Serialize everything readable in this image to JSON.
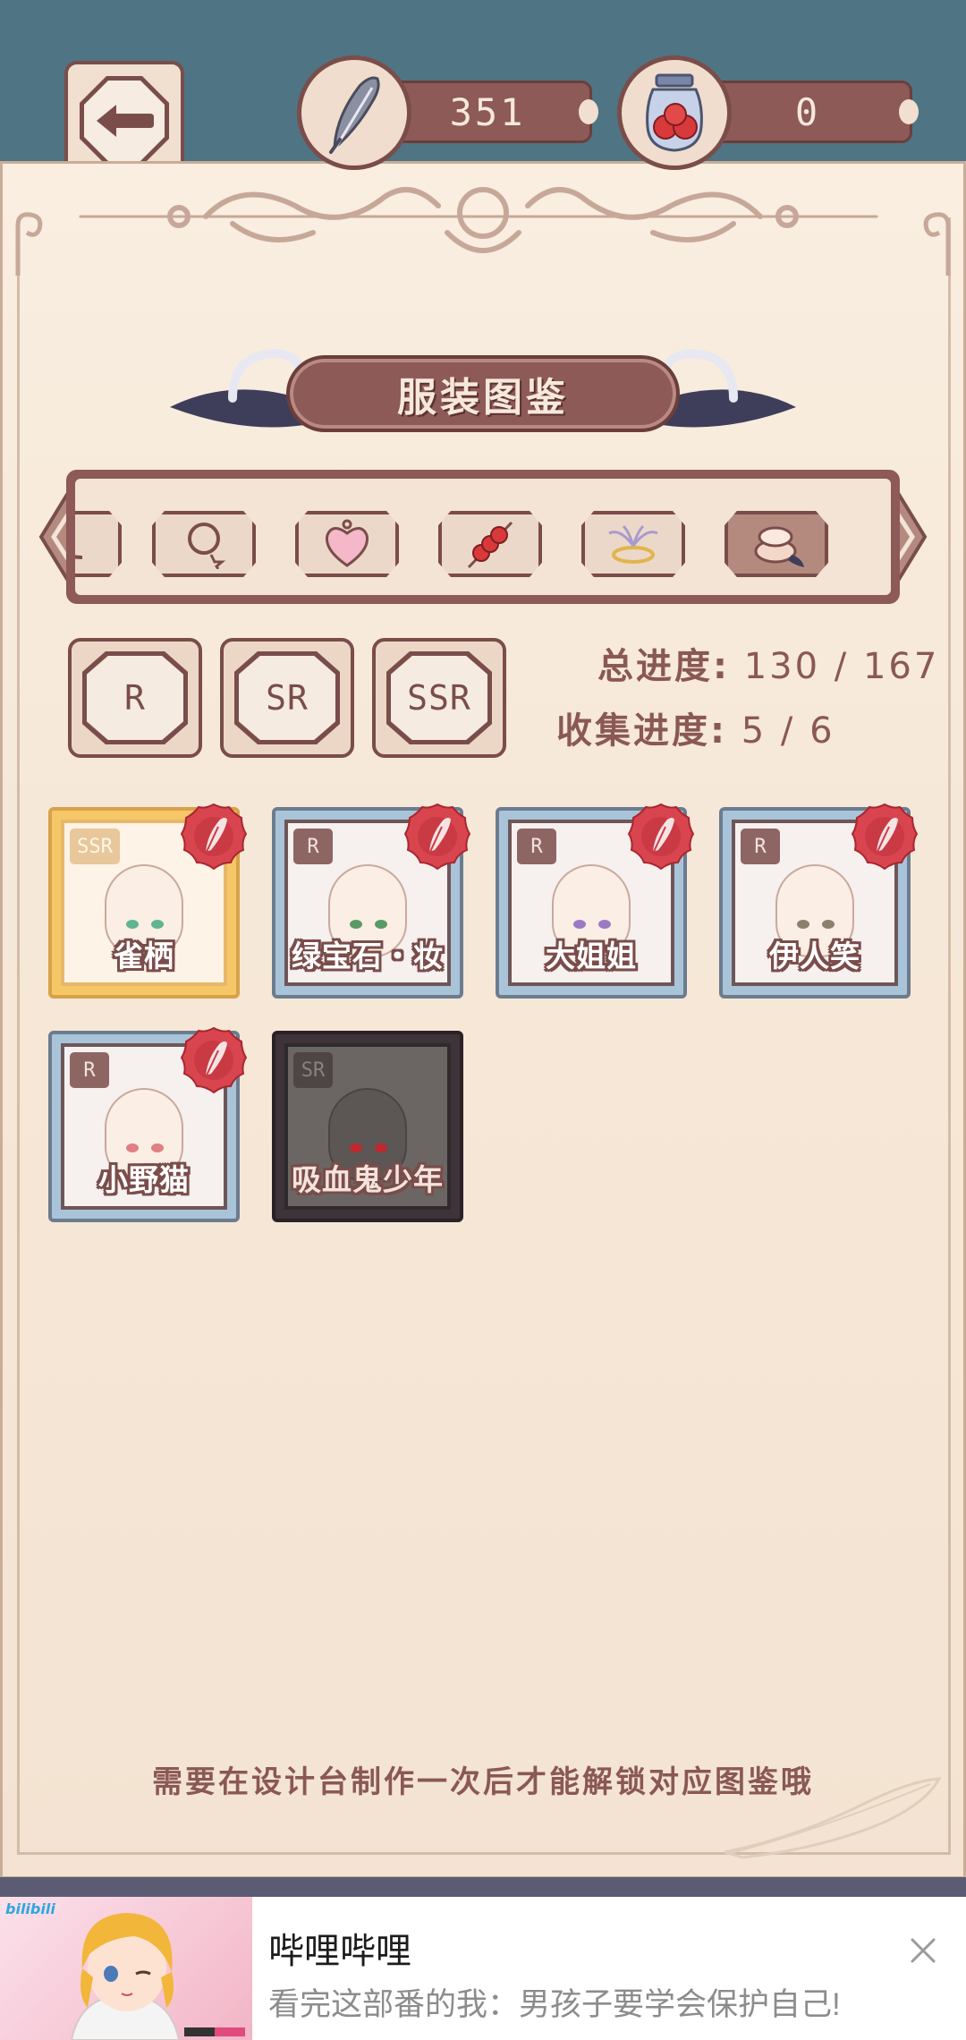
{
  "header": {
    "feather_count": "351",
    "jar_count": "0"
  },
  "title": "服装图鉴",
  "categories": [
    {
      "icon": "necklace-icon"
    },
    {
      "icon": "ring-pendant-icon"
    },
    {
      "icon": "heart-locket-icon"
    },
    {
      "icon": "candied-haws-icon"
    },
    {
      "icon": "halo-ribbon-icon"
    },
    {
      "icon": "compact-mirror-icon"
    }
  ],
  "rarity_filters": [
    "R",
    "SR",
    "SSR"
  ],
  "progress": {
    "total_label": "总进度:",
    "total_value": "130 / 167",
    "collect_label": "收集进度:",
    "collect_value": "5 / 6"
  },
  "cards": [
    {
      "rarity": "SSR",
      "name": "雀栖",
      "eye_color": "#5fb58f",
      "locked": false,
      "has_seal": true
    },
    {
      "rarity": "R",
      "name": "绿宝石・妆",
      "eye_color": "#5a9a64",
      "locked": false,
      "has_seal": true
    },
    {
      "rarity": "R",
      "name": "大姐姐",
      "eye_color": "#9a7ac4",
      "locked": false,
      "has_seal": true
    },
    {
      "rarity": "R",
      "name": "伊人笑",
      "eye_color": "#8c7f6e",
      "locked": false,
      "has_seal": true
    },
    {
      "rarity": "R",
      "name": "小野猫",
      "eye_color": "#e07f84",
      "locked": false,
      "has_seal": true
    },
    {
      "rarity": "SR",
      "name": "吸血鬼少年",
      "eye_color": "#c0282e",
      "locked": true,
      "has_seal": false
    }
  ],
  "hint": "需要在设计台制作一次后才能解锁对应图鉴哦",
  "ad": {
    "brand": "bilibili",
    "title": "哔哩哔哩",
    "subtitle": "看完这部番的我：男孩子要学会保护自己!"
  },
  "colors": {
    "sky": "#4f7484",
    "brown": "#8d5a58",
    "parchment": "#f9eee0",
    "seal_red": "#d8454e"
  }
}
